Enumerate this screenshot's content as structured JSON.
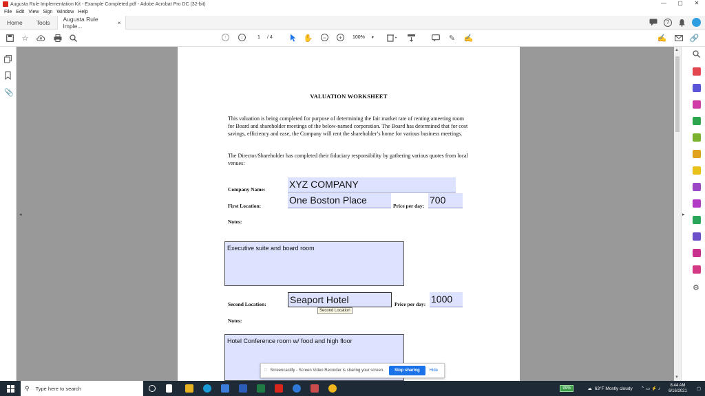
{
  "window": {
    "title": "Augusta Rule Implementation Kit - Example Completed.pdf - Adobe Acrobat Pro DC (32-bit)",
    "controls": [
      "—",
      "▢",
      "✕"
    ]
  },
  "menu": [
    "File",
    "Edit",
    "View",
    "Sign",
    "Window",
    "Help"
  ],
  "tabs": {
    "home": "Home",
    "tools": "Tools",
    "document": "Augusta Rule Imple...",
    "close": "×"
  },
  "toolbar": {
    "page_current": "1",
    "page_total": "/ 4",
    "zoom": "100%"
  },
  "document": {
    "heading": "VALUATION WORKSHEET",
    "para1": "This valuation is being completed for purpose of determining the fair market rate of renting ameeting room for Board and shareholder meetings of the below-named corporation. The Board has determined that for cost savings, efficiency and ease, the Company will rent the shareholder’s home for various business meetings.",
    "para2": "The Director/Shareholder has completed their fiduciary responsibility by gathering various quotes from local venues:",
    "company_label": "Company Name:",
    "company_value": "XYZ COMPANY",
    "first_location_label": "First Location:",
    "first_location_value": "One Boston Place",
    "price_label_1": "Price per day:",
    "price_value_1": "700",
    "notes_label_1": "Notes:",
    "notes_value_1": "Executive suite and board room",
    "second_location_label": "Second Location:",
    "second_location_value": "Seaport Hotel",
    "price_label_2": "Price per day:",
    "price_value_2": "1000",
    "tooltip": "Second Location",
    "notes_label_2": "Notes:",
    "notes_value_2": "Hotel Conference room w/ food and high floor"
  },
  "share_bar": {
    "dots": "⁞⁞",
    "message": "Screencastify - Screen Video Recorder is sharing your screen.",
    "stop": "Stop sharing",
    "hide": "Hide"
  },
  "taskbar": {
    "search_placeholder": "Type here to search",
    "battery": "99%",
    "weather": "63°F  Mostly cloudy",
    "time": "8:44 AM",
    "date": "6/16/2021"
  },
  "colors": {
    "form_field": "#dde3ff",
    "viewer_bg": "#999999",
    "accent": "#1a73e8",
    "taskbar": "#1e2a35"
  }
}
